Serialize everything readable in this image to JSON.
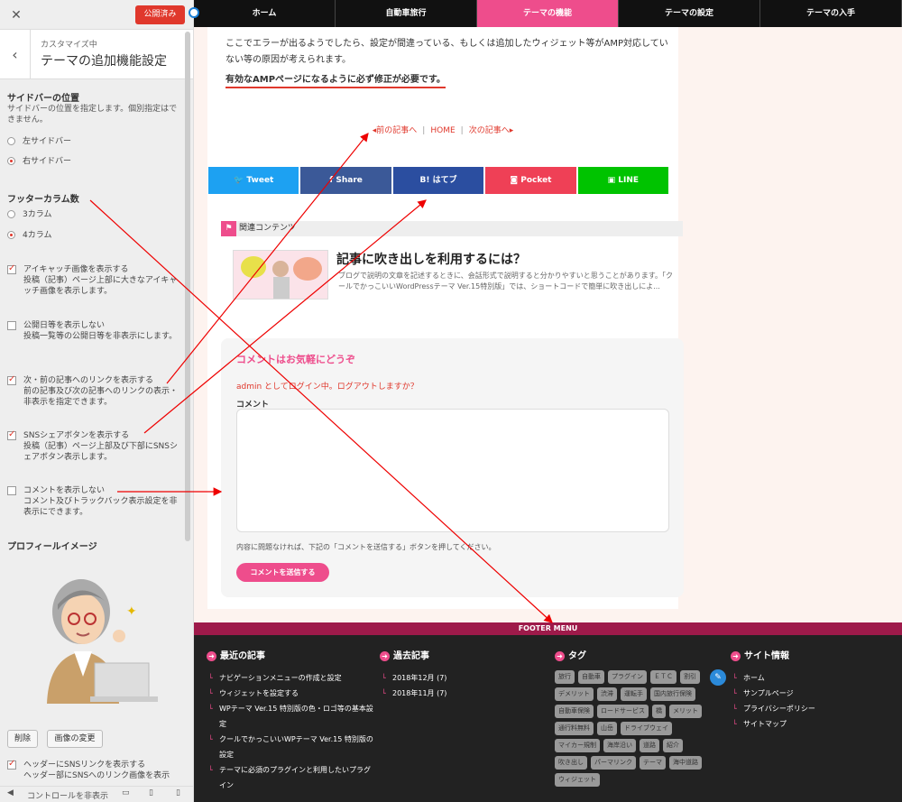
{
  "panel": {
    "close_icon": "close-icon",
    "publish": "公開済み",
    "back_icon": "back-icon",
    "subtitle": "カスタマイズ中",
    "title": "テーマの追加機能設定",
    "sidebar_title": "サイドバーの位置",
    "sidebar_desc": "サイドバーの位置を指定します。個別指定はできません。",
    "sidebar_left": "左サイドバー",
    "sidebar_right": "右サイドバー",
    "footer_title": "フッターカラム数",
    "footer_3": "3カラム",
    "footer_4": "4カラム",
    "cb1": "アイキャッチ画像を表示する",
    "cb1_desc": "投稿（記事）ページ上部に大きなアイキャッチ画像を表示します。",
    "cb2": "公開日等を表示しない",
    "cb2_desc": "投稿一覧等の公開日等を非表示にします。",
    "cb3": "次・前の記事へのリンクを表示する",
    "cb3_desc": "前の記事及び次の記事へのリンクの表示・非表示を指定できます。",
    "cb4": "SNSシェアボタンを表示する",
    "cb4_desc": "投稿（記事）ページ上部及び下部にSNSシェアボタン表示します。",
    "cb5": "コメントを表示しない",
    "cb5_desc": "コメント及びトラックバック表示設定を非表示にできます。",
    "profile_title": "プロフィールイメージ",
    "remove": "削除",
    "change": "画像の変更",
    "cb6": "ヘッダーにSNSリンクを表示する",
    "cb6_desc": "ヘッダー部にSNSへのリンク画像を表示",
    "hide_controls": "コントロールを非表示"
  },
  "nav": [
    "ホーム",
    "自動車旅行",
    "テーマの機能",
    "テーマの設定",
    "テーマの入手"
  ],
  "article": {
    "p1": "ここでエラーが出るようでしたら、設定が間違っている、もしくは追加したウィジェット等がAMP対応していない等の原因が考えられます。",
    "p2": "有効なAMPページになるように必ず修正が必要です。",
    "prev": "前の記事へ",
    "home": "HOME",
    "next": "次の記事へ",
    "share": [
      "Tweet",
      "Share",
      "はてブ",
      "Pocket",
      "LINE"
    ],
    "share_colors": [
      "#1da1f2",
      "#3b5998",
      "#00a4de",
      "#ef4056",
      "#00c300"
    ],
    "related": "関連コンテンツ",
    "rel_title": "記事に吹き出しを利用するには？",
    "rel_desc": "ブログで説明の文章を記述するときに、会話形式で説明すると分かりやすいと思うことがあります。「クールでかっこいいWordPressテーマ Ver.15特別版」では、ショートコードで簡単に吹き出しによ...",
    "comment_title": "コメントはお気軽にどうぞ",
    "login": "admin としてログイン中。ログアウトしますか？",
    "comment_label": "コメント",
    "comment_note": "内容に問題なければ、下記の「コメントを送信する」ボタンを押してください。",
    "submit": "コメントを送信する"
  },
  "footer": {
    "bar": "FOOTER MENU",
    "recent_title": "最近の記事",
    "recent": [
      "ナビゲーションメニューの作成と設定",
      "ウィジェットを設定する",
      "WPテーマ Ver.15 特別版の色・ロゴ等の基本設定",
      "クールでかっこいいWPテーマ Ver.15 特別版の設定",
      "テーマに必須のプラグインと利用したいプラグイン"
    ],
    "archive_title": "過去記事",
    "archive": [
      "2018年12月 (7)",
      "2018年11月 (7)"
    ],
    "tag_title": "タグ",
    "tags": [
      "旅行",
      "自動車",
      "プラグイン",
      "ＥＴＣ",
      "割引",
      "デメリット",
      "渋滞",
      "運転手",
      "国内旅行保険",
      "自動車保険",
      "ロードサービス",
      "橋",
      "メリット",
      "通行料無料",
      "山岳",
      "ドライブウェイ",
      "マイカー規制",
      "海岸沿い",
      "道路",
      "紹介",
      "吹き出し",
      "パーマリンク",
      "テーマ",
      "海中道路",
      "ウィジェット"
    ],
    "site_title": "サイト情報",
    "site": [
      "ホーム",
      "サンプルページ",
      "プライバシーポリシー",
      "サイトマップ"
    ]
  }
}
